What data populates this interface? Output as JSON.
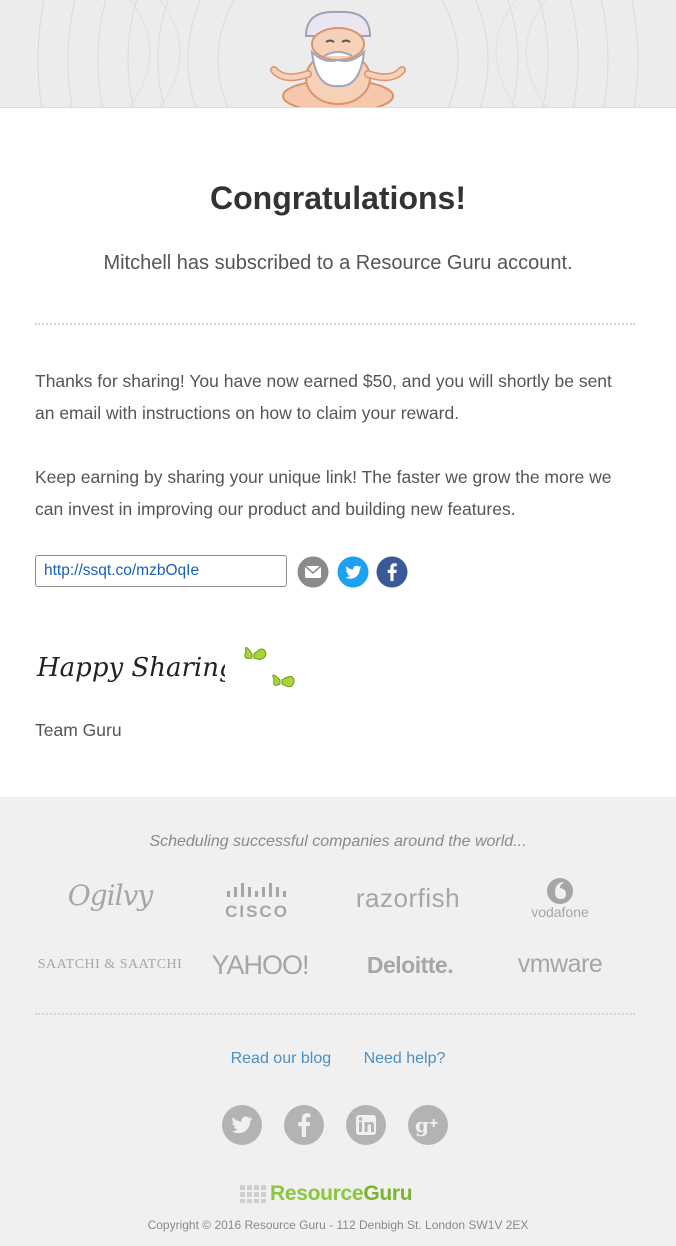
{
  "header": {
    "mascot_icon": "meditating-guru-icon"
  },
  "main": {
    "title": "Congratulations!",
    "subtitle": "Mitchell has subscribed to a Resource Guru account.",
    "paragraph1": "Thanks for sharing! You have now earned $50, and you will shortly be sent an email with instructions on how to claim your reward.",
    "paragraph2": "Keep earning by sharing your unique link! The faster we grow the more we can invest in improving our product and building new features.",
    "share_link": "http://ssqt.co/mzbOqIe",
    "share_icons": [
      "email-icon",
      "twitter-icon",
      "facebook-icon"
    ],
    "signature_text": "Happy Sharing!",
    "signoff": "Team Guru"
  },
  "footer": {
    "tagline": "Scheduling successful companies around the world...",
    "logos": {
      "ogilvy": "Ogilvy",
      "cisco": "CISCO",
      "razorfish": "razorfish",
      "vodafone": "vodafone",
      "saatchi": "SAATCHI & SAATCHI",
      "yahoo": "YAHOO!",
      "deloitte": "Deloitte.",
      "vmware": "vmware"
    },
    "links": {
      "blog": "Read our blog",
      "help": "Need help?"
    },
    "social_icons": [
      "twitter-icon",
      "facebook-icon",
      "linkedin-icon",
      "google-plus-icon"
    ],
    "brand_resource": "Resource",
    "brand_guru": "Guru",
    "copyright": "Copyright © 2016 Resource Guru - 112 Denbigh St. London SW1V 2EX"
  },
  "colors": {
    "accent_green": "#8cc63f",
    "link_blue": "#4a90c8",
    "twitter_blue": "#1da1f2",
    "facebook_blue": "#3b5998",
    "footer_bg": "#f0f0f0"
  }
}
